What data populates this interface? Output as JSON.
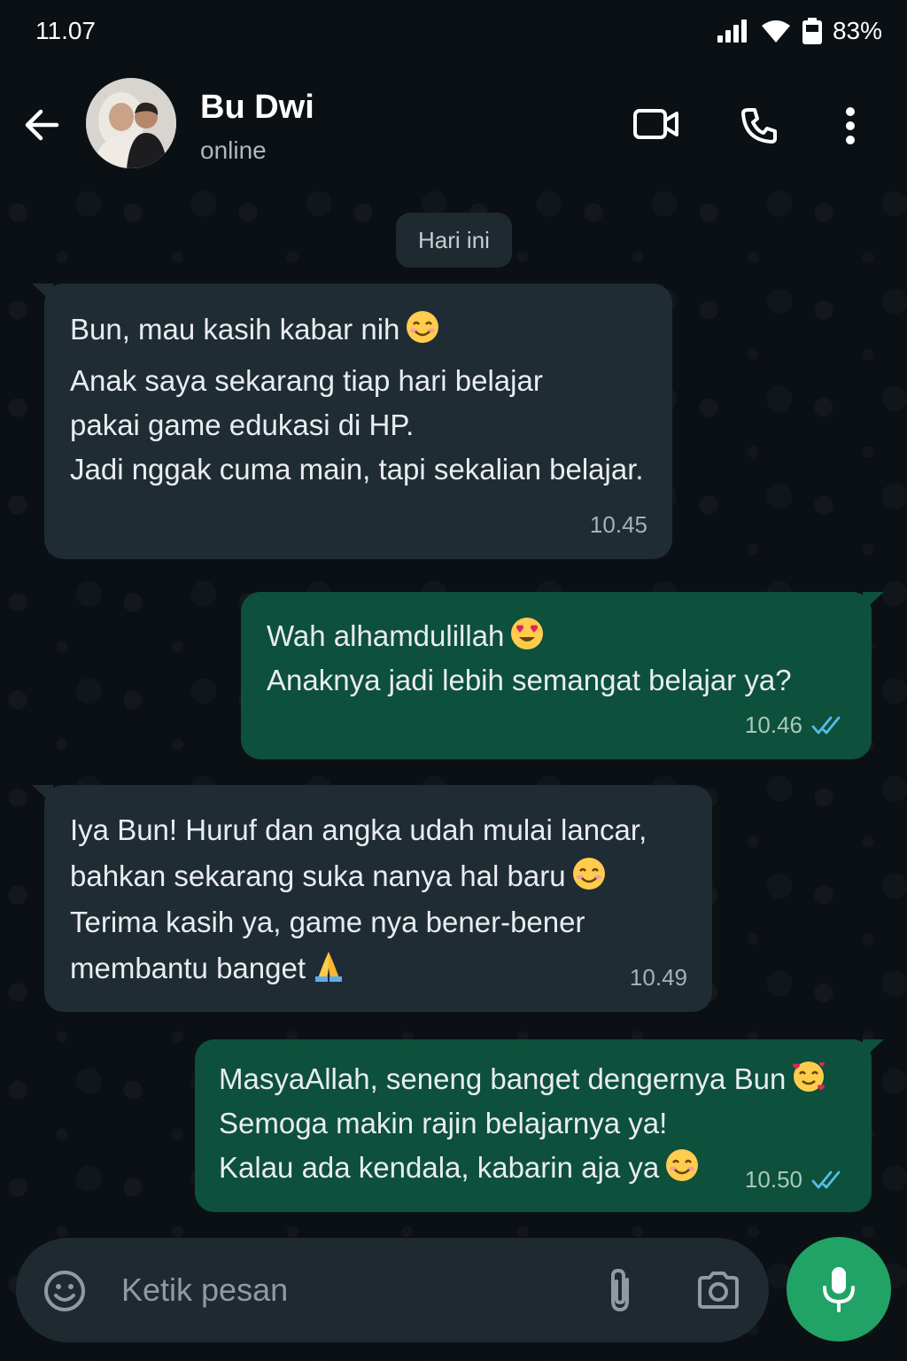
{
  "status_bar": {
    "time": "11.07",
    "battery": "83%"
  },
  "header": {
    "contact_name": "Bu Dwi",
    "contact_status": "online",
    "icons": [
      "back-arrow-icon",
      "video-call-icon",
      "phone-icon",
      "more-vert-icon"
    ]
  },
  "chat": {
    "date_label": "Hari ini",
    "messages": [
      {
        "direction": "in",
        "lines": [
          "Bun, mau kasih kabar nih",
          "Anak saya sekarang tiap hari belajar",
          "pakai game edukasi di HP.",
          "Jadi nggak cuma main, tapi sekalian belajar."
        ],
        "emoji": "😊",
        "time": "10.45"
      },
      {
        "direction": "out",
        "lines": [
          "Wah alhamdulillah",
          "Anaknya jadi lebih semangat belajar ya?"
        ],
        "emoji": "😍",
        "time": "10.46",
        "status": "read"
      },
      {
        "direction": "in",
        "lines": [
          "Iya Bun! Huruf dan angka udah mulai lancar,",
          "bahkan sekarang suka nanya hal baru",
          "Terima kasih ya, game nya bener-bener",
          "membantu banget"
        ],
        "emojis": [
          "😊",
          "🙏"
        ],
        "time": "10.49"
      },
      {
        "direction": "out",
        "lines": [
          "MasyaAllah, seneng banget dengernya Bun",
          "Semoga makin rajin belajarnya ya!",
          "Kalau ada kendala, kabarin aja ya"
        ],
        "emojis": [
          "🥰",
          "😊"
        ],
        "time": "10.50",
        "status": "read"
      }
    ]
  },
  "composer": {
    "placeholder": "Ketik pesan",
    "icons": [
      "emoji-icon",
      "attach-icon",
      "camera-icon",
      "mic-icon"
    ]
  },
  "colors": {
    "background": "#0b1014",
    "incoming_bubble": "#202c33",
    "outgoing_bubble": "#0d503b",
    "accent_green": "#21a366",
    "read_tick": "#53bdeb"
  }
}
